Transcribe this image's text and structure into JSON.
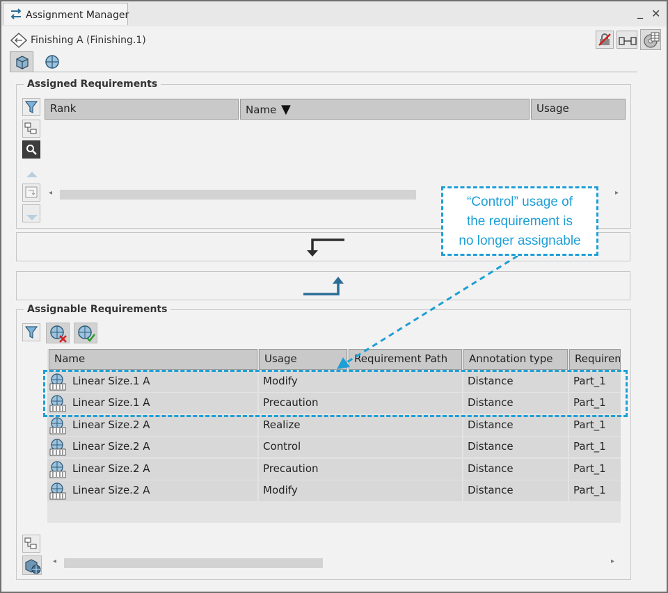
{
  "window": {
    "title": "Assignment Manager",
    "context_label": "Finishing A (Finishing.1)",
    "minimize_symbol": "_",
    "close_symbol": "✕"
  },
  "toolbar": {
    "icons": [
      "lock-disabled-icon",
      "link-icon",
      "settings-table-icon"
    ]
  },
  "tabs": [
    "product-tab-icon",
    "requirement-tab-icon"
  ],
  "assigned": {
    "title": "Assigned Requirements",
    "columns": [
      "Rank",
      "Name",
      "Usage"
    ],
    "sort_indicator": "▼"
  },
  "assignable": {
    "title": "Assignable Requirements",
    "columns": [
      "Name",
      "Usage",
      "Requirement Path",
      "Annotation type",
      "Requirement"
    ],
    "rows": [
      {
        "name": "Linear Size.1 A",
        "usage": "Modify",
        "path": "",
        "annotation": "Distance",
        "requirement": "Part_1"
      },
      {
        "name": "Linear Size.1 A",
        "usage": "Precaution",
        "path": "",
        "annotation": "Distance",
        "requirement": "Part_1"
      },
      {
        "name": "Linear Size.2 A",
        "usage": "Realize",
        "path": "",
        "annotation": "Distance",
        "requirement": "Part_1"
      },
      {
        "name": "Linear Size.2 A",
        "usage": "Control",
        "path": "",
        "annotation": "Distance",
        "requirement": "Part_1"
      },
      {
        "name": "Linear Size.2 A",
        "usage": "Precaution",
        "path": "",
        "annotation": "Distance",
        "requirement": "Part_1"
      },
      {
        "name": "Linear Size.2 A",
        "usage": "Modify",
        "path": "",
        "annotation": "Distance",
        "requirement": "Part_1"
      }
    ]
  },
  "callout": {
    "line1": "“Control” usage of",
    "line2": "the requirement is",
    "line3": "no longer assignable",
    "color": "#1e9fd6"
  },
  "colors": {
    "header_bg": "#c9c9c9",
    "row_bg": "#d8d8d8",
    "arrow_dark": "#2d2d2d",
    "arrow_blue": "#2b6d96"
  }
}
